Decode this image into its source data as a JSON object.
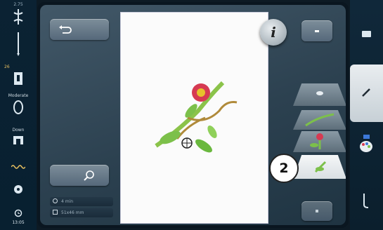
{
  "statusbar": {
    "top_value": "2.75",
    "needle_number": "26",
    "presser_foot_label": "Moderate",
    "feed_dog_label": "Down"
  },
  "clock": {
    "time": "13:05"
  },
  "toolbar": {
    "info_label": "i"
  },
  "info": {
    "sewing_time": "4 min",
    "dimensions": "51x46 mm"
  },
  "callout": {
    "number": "2"
  },
  "icons": [
    "undo-icon",
    "zoom-icon",
    "info-icon",
    "folder-icon",
    "brush-icon",
    "color-palette-icon",
    "thread-icon",
    "needle-icon",
    "presser-foot-icon",
    "bobbin-icon",
    "clock-icon"
  ],
  "colors": {
    "panel": "#34495a",
    "canvas": "#fbfbfb",
    "active_tab": "#dfe4e8",
    "status_accent": "#e8c060"
  }
}
